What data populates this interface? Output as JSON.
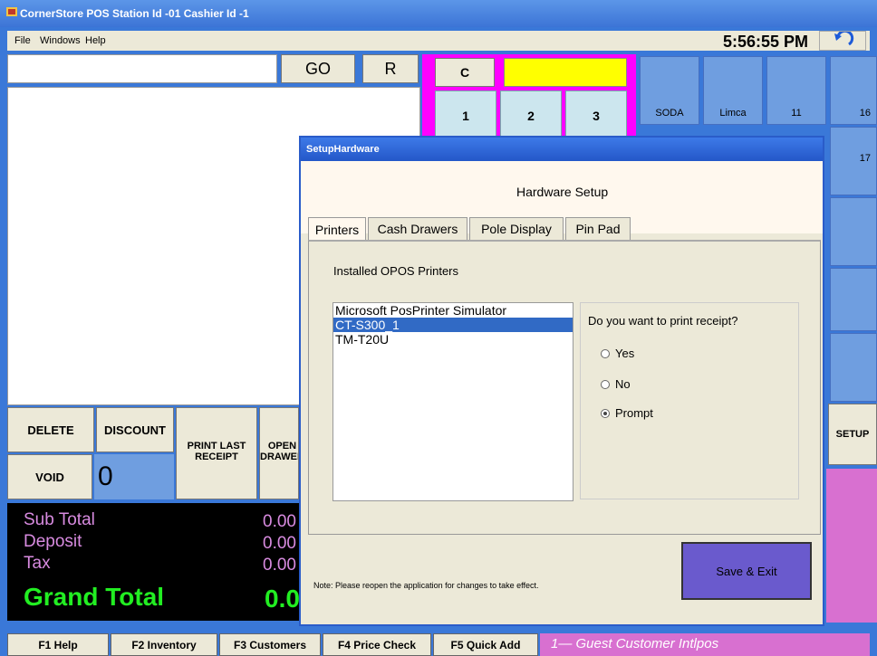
{
  "window": {
    "title": "CornerStore POS Station Id -01 Cashier Id -1"
  },
  "menu": {
    "items": [
      "File",
      "Windows",
      "Help"
    ],
    "clock": "5:56:55 PM"
  },
  "entry": {
    "go": "GO",
    "r": "R",
    "c": "C"
  },
  "numpad": [
    "1",
    "2",
    "3"
  ],
  "products": {
    "soda": "SODA",
    "limca": "Limca",
    "n11": "11",
    "n16": "16",
    "n17": "17",
    "setup": "SETUP"
  },
  "actions": {
    "delete": "DELETE",
    "discount": "DISCOUNT",
    "print_last": "PRINT LAST RECEIPT",
    "open_drawer": "OPEN DRAWER",
    "void": "VOID",
    "qty": "0"
  },
  "totals": {
    "subtotal_label": "Sub Total",
    "subtotal": "0.00",
    "deposit_label": "Deposit",
    "deposit": "0.00",
    "tax_label": "Tax",
    "tax": "0.00",
    "grand_label": "Grand Total",
    "grand": "0.0"
  },
  "fkeys": [
    "F1 Help",
    "F2 Inventory",
    "F3 Customers",
    "F4 Price Check",
    "F5 Quick Add"
  ],
  "status": {
    "text": "1—      Guest Customer  Intlpos"
  },
  "dialog": {
    "title": "SetupHardware",
    "heading": "Hardware Setup",
    "tabs": [
      "Printers",
      "Cash Drawers",
      "Pole Display",
      "Pin Pad"
    ],
    "installed_label": "Installed OPOS Printers",
    "printers": [
      "Microsoft PosPrinter Simulator",
      "CT-S300_1",
      "TM-T20U"
    ],
    "selected_printer": "CT-S300_1",
    "question": "Do you want to print receipt?",
    "options": [
      "Yes",
      "No",
      "Prompt"
    ],
    "selected_option": "Prompt",
    "note": "Note: Please reopen the application for changes to take effect.",
    "save": "Save & Exit"
  },
  "colors": {
    "accent_magenta": "#ff00ff",
    "accent_yellow": "#ffff00",
    "save_button": "#6a5acd",
    "grand_total": "#22ee22"
  }
}
